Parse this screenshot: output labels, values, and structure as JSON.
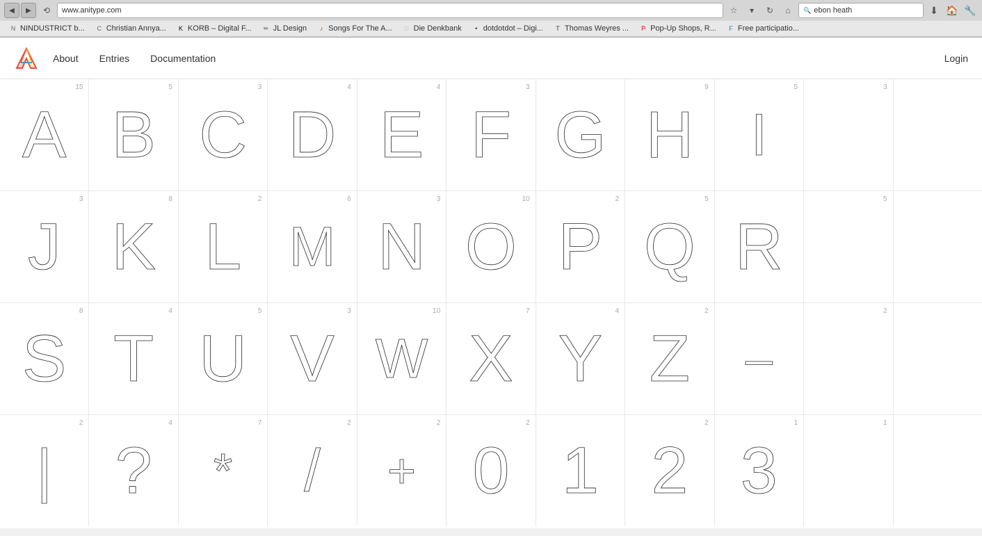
{
  "browser": {
    "url": "www.anitype.com",
    "search_text": "ebon heath",
    "bookmarks": [
      {
        "id": "bm1",
        "label": "NINDUSTRICT b...",
        "favicon": "N"
      },
      {
        "id": "bm2",
        "label": "Christian Annya...",
        "favicon": "C"
      },
      {
        "id": "bm3",
        "label": "KORB – Digital F...",
        "favicon": "K",
        "color": "#000"
      },
      {
        "id": "bm4",
        "label": "JL Design",
        "favicon": "✏",
        "color": "#555"
      },
      {
        "id": "bm5",
        "label": "Songs For The A...",
        "favicon": "♪",
        "color": "#8B4513"
      },
      {
        "id": "bm6",
        "label": "Die Denkbank",
        "favicon": "D",
        "color": "#ccc"
      },
      {
        "id": "bm7",
        "label": "dotdotdot – Digi...",
        "favicon": "•",
        "color": "#333"
      },
      {
        "id": "bm8",
        "label": "Thomas Weyres ...",
        "favicon": "T",
        "color": "#444"
      },
      {
        "id": "bm9",
        "label": "Pop-Up Shops, R...",
        "favicon": "P",
        "color": "#e00"
      },
      {
        "id": "bm10",
        "label": "Free participatio...",
        "favicon": "F",
        "color": "#3377cc"
      }
    ]
  },
  "nav": {
    "about_label": "About",
    "entries_label": "Entries",
    "documentation_label": "Documentation",
    "login_label": "Login"
  },
  "grid": {
    "cells": [
      {
        "letter": "A",
        "count": "15"
      },
      {
        "letter": "B",
        "count": "5"
      },
      {
        "letter": "C",
        "count": "3"
      },
      {
        "letter": "D",
        "count": "4"
      },
      {
        "letter": "E",
        "count": "4"
      },
      {
        "letter": "F",
        "count": "3"
      },
      {
        "letter": "G",
        "count": ""
      },
      {
        "letter": "H",
        "count": "9"
      },
      {
        "letter": "I",
        "count": "5"
      },
      {
        "letter": "",
        "count": "3"
      },
      {
        "letter": "J",
        "count": "3"
      },
      {
        "letter": "K",
        "count": "8"
      },
      {
        "letter": "L",
        "count": "2"
      },
      {
        "letter": "M",
        "count": "6"
      },
      {
        "letter": "N",
        "count": "3"
      },
      {
        "letter": "O",
        "count": "10"
      },
      {
        "letter": "P",
        "count": "2"
      },
      {
        "letter": "Q",
        "count": "5"
      },
      {
        "letter": "R",
        "count": ""
      },
      {
        "letter": "",
        "count": "5"
      },
      {
        "letter": "S",
        "count": "8"
      },
      {
        "letter": "T",
        "count": "4"
      },
      {
        "letter": "U",
        "count": "5"
      },
      {
        "letter": "V",
        "count": "3"
      },
      {
        "letter": "W",
        "count": "10"
      },
      {
        "letter": "X",
        "count": "7"
      },
      {
        "letter": "Y",
        "count": "4"
      },
      {
        "letter": "Z",
        "count": "2"
      },
      {
        "letter": "–",
        "count": ""
      },
      {
        "letter": "",
        "count": "2"
      },
      {
        "letter": "I",
        "count": "2"
      },
      {
        "letter": "?",
        "count": "4"
      },
      {
        "letter": "*",
        "count": "7"
      },
      {
        "letter": "/",
        "count": "2"
      },
      {
        "letter": "+",
        "count": "2"
      },
      {
        "letter": "0",
        "count": "2"
      },
      {
        "letter": "1",
        "count": ""
      },
      {
        "letter": "2",
        "count": "2"
      },
      {
        "letter": "3",
        "count": "1"
      },
      {
        "letter": "",
        "count": "1"
      }
    ]
  }
}
